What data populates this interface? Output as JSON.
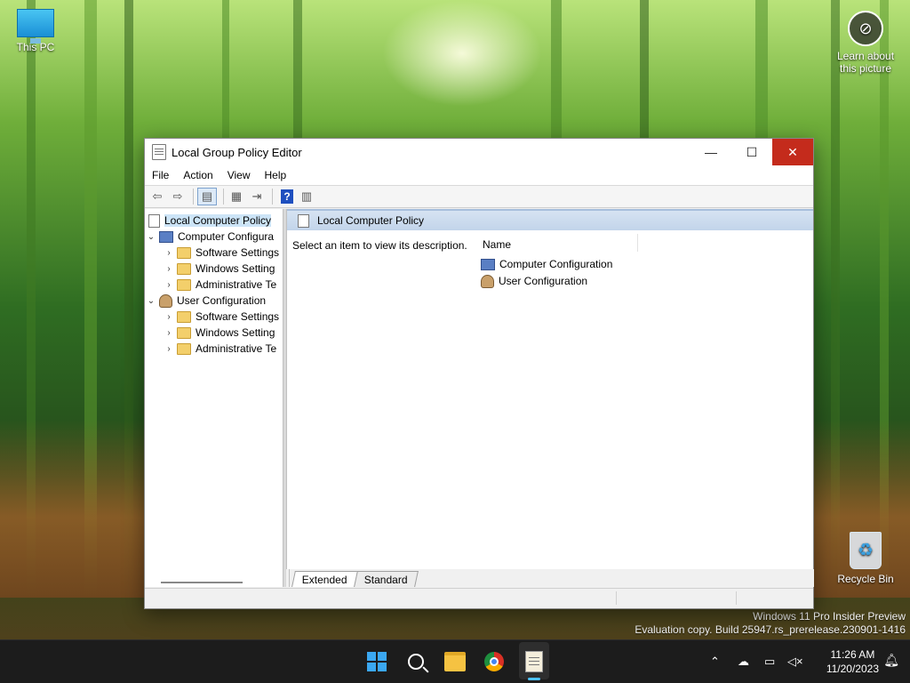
{
  "desktop": {
    "this_pc_label": "This PC",
    "learn_label_line1": "Learn about",
    "learn_label_line2": "this picture",
    "recycle_bin_label": "Recycle Bin",
    "watermark_line1": "Windows 11 Pro Insider Preview",
    "watermark_line2": "Evaluation copy. Build 25947.rs_prerelease.230901-1416"
  },
  "window": {
    "title": "Local Group Policy Editor",
    "menu": [
      "File",
      "Action",
      "View",
      "Help"
    ],
    "tree": {
      "root": "Local Computer Policy",
      "computer_config": "Computer Configura",
      "computer_children": [
        "Software Settings",
        "Windows Setting",
        "Administrative Te"
      ],
      "user_config": "User Configuration",
      "user_children": [
        "Software Settings",
        "Windows Setting",
        "Administrative Te"
      ]
    },
    "detail": {
      "header": "Local Computer Policy",
      "description": "Select an item to view its description.",
      "column_name": "Name",
      "items": [
        "Computer Configuration",
        "User Configuration"
      ]
    },
    "tabs": [
      "Extended",
      "Standard"
    ]
  },
  "taskbar": {
    "time": "11:26 AM",
    "date": "11/20/2023"
  },
  "colors": {
    "close_red": "#c42b1c",
    "selection": "#cce4f7",
    "taskbar": "#1c1c1c",
    "accent": "#4cc2ff"
  }
}
